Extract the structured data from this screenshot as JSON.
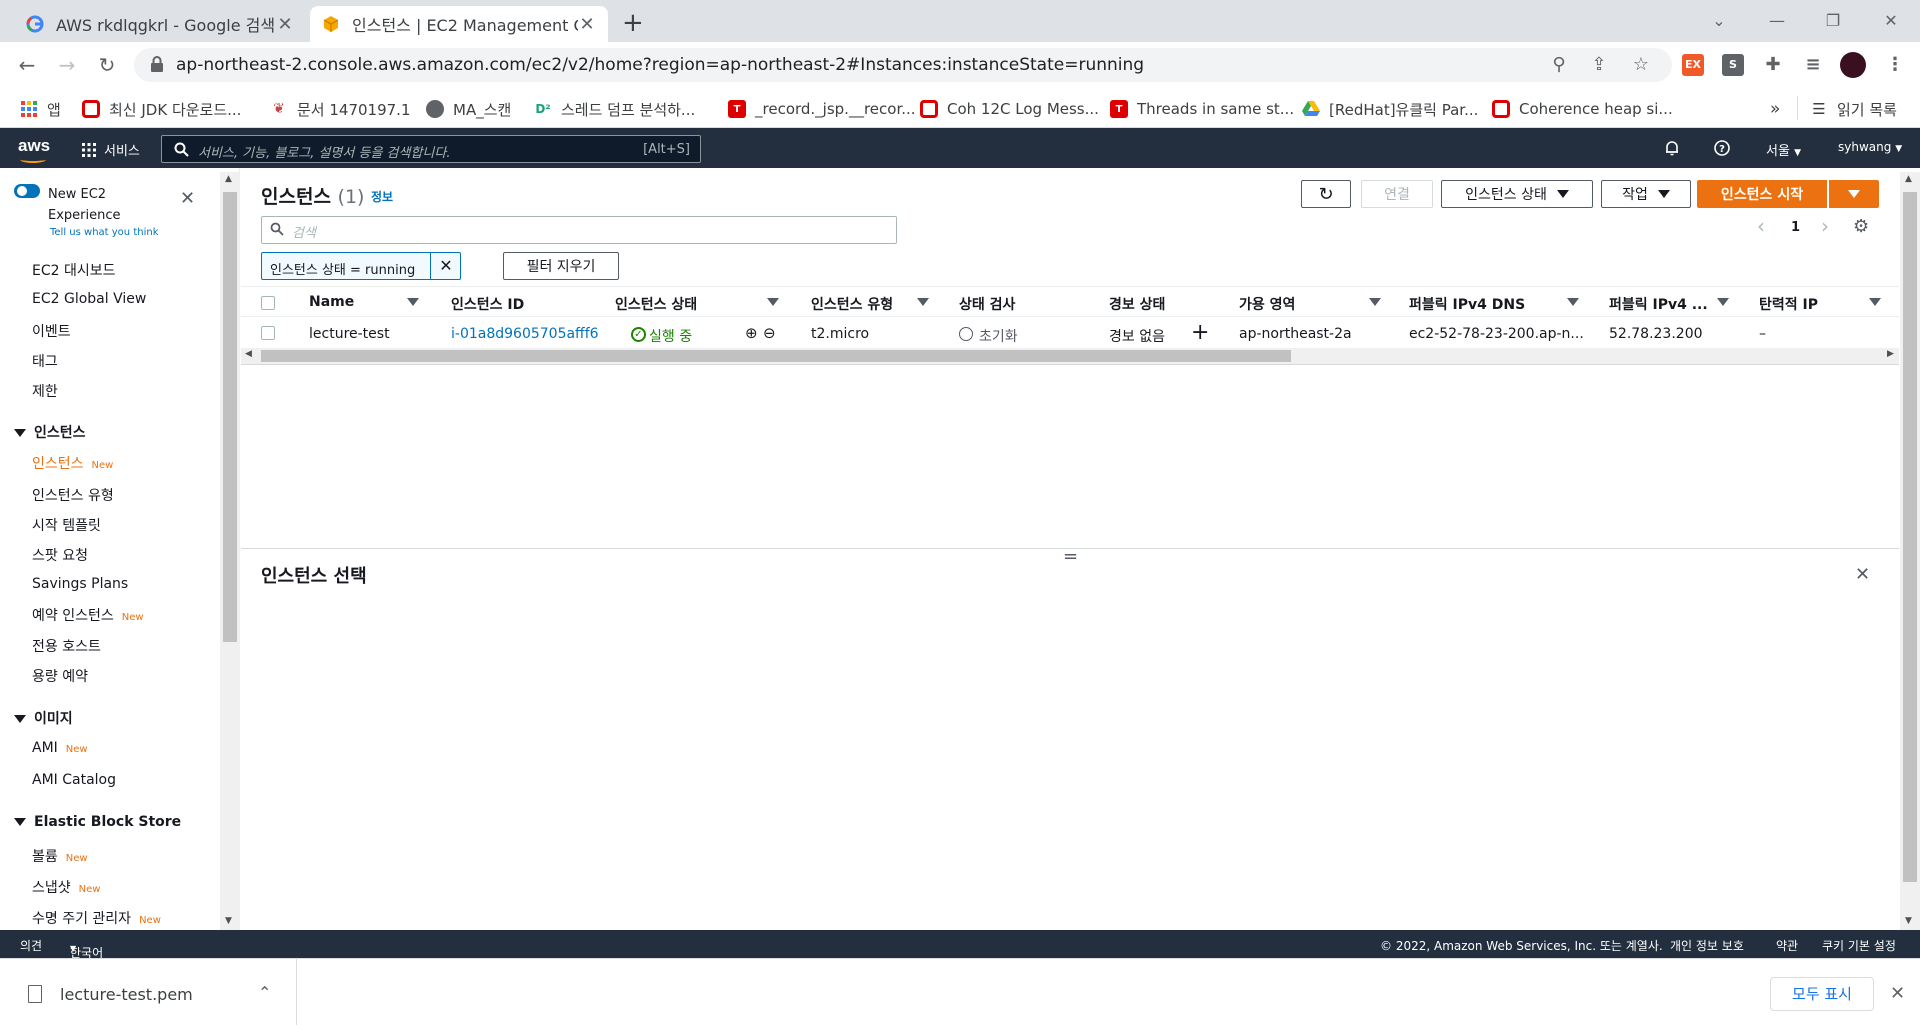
{
  "browser": {
    "tabs": [
      {
        "title": "AWS rkdlqgkrl - Google 검색",
        "active": false
      },
      {
        "title": "인스턴스 | EC2 Management Co",
        "active": true
      }
    ],
    "new_tab": "+",
    "url": "ap-northeast-2.console.aws.amazon.com/ec2/v2/home?region=ap-northeast-2#Instances:instanceState=running",
    "extensions": [
      "EX",
      "S"
    ],
    "bookmarks": [
      {
        "label": "앱"
      },
      {
        "label": "최신 JDK 다운로드..."
      },
      {
        "label": "문서 1470197.1"
      },
      {
        "label": "MA_스캔"
      },
      {
        "label": "스레드 덤프 분석하..."
      },
      {
        "label": "_record._jsp.__recor..."
      },
      {
        "label": "Coh 12C Log Mess..."
      },
      {
        "label": "Threads in same st..."
      },
      {
        "label": "[RedHat]유클릭 Par..."
      },
      {
        "label": "Coherence heap si..."
      }
    ],
    "bookmarks_more": "»",
    "reading_list": "읽기 목록"
  },
  "aws_header": {
    "logo": "aws",
    "services": "서비스",
    "search_placeholder": "서비스, 기능, 블로그, 설명서 등을 검색합니다.",
    "search_shortcut": "[Alt+S]",
    "region": "서울",
    "user": "syhwang"
  },
  "sidebar": {
    "new_experience_title": "New EC2 Experience",
    "new_experience_link": "Tell us what you think",
    "items_top": [
      "EC2 대시보드",
      "EC2 Global View",
      "이벤트",
      "태그",
      "제한"
    ],
    "sections": [
      {
        "title": "인스턴스",
        "items": [
          {
            "label": "인스턴스",
            "new": "New",
            "active": true
          },
          {
            "label": "인스턴스 유형"
          },
          {
            "label": "시작 템플릿"
          },
          {
            "label": "스팟 요청"
          },
          {
            "label": "Savings Plans"
          },
          {
            "label": "예약 인스턴스",
            "new": "New"
          },
          {
            "label": "전용 호스트"
          },
          {
            "label": "용량 예약"
          }
        ]
      },
      {
        "title": "이미지",
        "items": [
          {
            "label": "AMI",
            "new": "New"
          },
          {
            "label": "AMI Catalog"
          }
        ]
      },
      {
        "title": "Elastic Block Store",
        "items": [
          {
            "label": "볼륨",
            "new": "New"
          },
          {
            "label": "스냅샷",
            "new": "New"
          },
          {
            "label": "수명 주기 관리자",
            "new": "New"
          }
        ]
      }
    ]
  },
  "main": {
    "title": "인스턴스",
    "count": "(1)",
    "info": "정보",
    "connect": "연결",
    "instance_state": "인스턴스 상태",
    "actions": "작업",
    "launch": "인스턴스 시작",
    "search_placeholder": "검색",
    "page": "1",
    "filter_token": "인스턴스 상태 = running",
    "clear_filters": "필터 지우기",
    "columns": [
      "Name",
      "인스턴스 ID",
      "인스턴스 상태",
      "인스턴스 유형",
      "상태 검사",
      "경보 상태",
      "가용 영역",
      "퍼블릭 IPv4 DNS",
      "퍼블릭 IPv4 ...",
      "탄력적 IP"
    ],
    "rows": [
      {
        "name": "lecture-test",
        "id": "i-01a8d9605705afff6",
        "state": "실행 중",
        "type": "t2.micro",
        "check": "초기화",
        "alarm": "경보 없음",
        "az": "ap-northeast-2a",
        "dns": "ec2-52-78-23-200.ap-n...",
        "ip": "52.78.23.200",
        "eip": "–"
      }
    ],
    "splitter": "=",
    "detail_title": "인스턴스 선택"
  },
  "footer": {
    "feedback": "의견",
    "language": "한국어",
    "copyright": "© 2022, Amazon Web Services, Inc. 또는 계열사.",
    "privacy": "개인 정보 보호",
    "terms": "약관",
    "cookies": "쿠키 기본 설정"
  },
  "downloads": {
    "file": "lecture-test.pem",
    "show_all": "모두 표시"
  },
  "colors": {
    "aws_nav": "#232f3e",
    "accent_orange": "#ec7211",
    "link_blue": "#0073bb",
    "running_green": "#1d8102"
  }
}
